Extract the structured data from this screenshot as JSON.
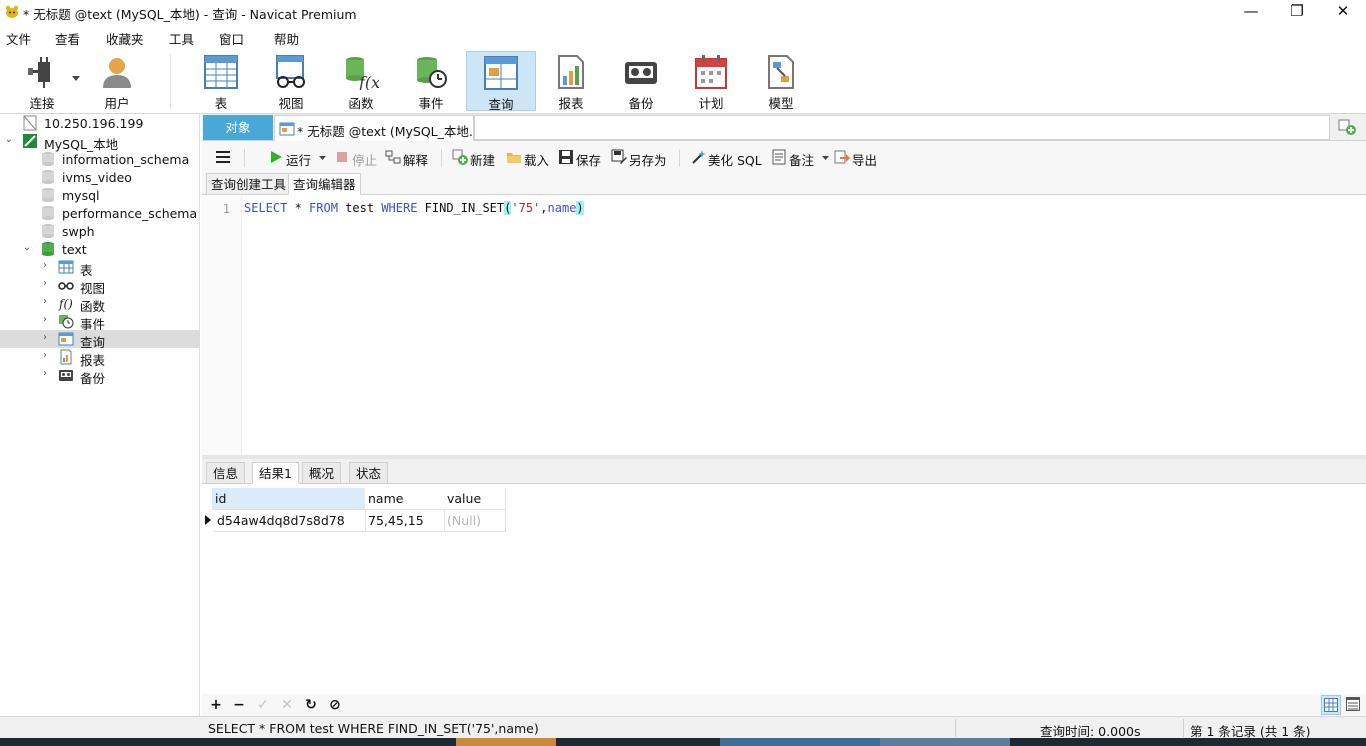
{
  "window": {
    "title": "* 无标题 @text (MySQL_本地) - 查询 - Navicat Premium",
    "minimize_glyph": "—",
    "restore_glyph": "❐",
    "close_glyph": "✕"
  },
  "menu": [
    "文件",
    "查看",
    "收藏夹",
    "工具",
    "窗口",
    "帮助"
  ],
  "toolbar": {
    "connect": "连接",
    "user": "用户",
    "table": "表",
    "view": "视图",
    "function": "函数",
    "event": "事件",
    "query": "查询",
    "report": "报表",
    "backup": "备份",
    "schedule": "计划",
    "model": "模型"
  },
  "navigator": {
    "host": "10.250.196.199",
    "connection": "MySQL_本地",
    "databases": [
      "information_schema",
      "ivms_video",
      "mysql",
      "performance_schema",
      "swph",
      "text"
    ],
    "children": [
      "表",
      "视图",
      "函数",
      "事件",
      "查询",
      "报表",
      "备份"
    ],
    "selected": "查询"
  },
  "tabs": {
    "objects": "对象",
    "query_tab": "* 无标题 @text (MySQL_本地..."
  },
  "query_toolbar": {
    "run": "运行",
    "stop": "停止",
    "explain": "解释",
    "new": "新建",
    "load": "载入",
    "save": "保存",
    "save_as": "另存为",
    "beautify": "美化 SQL",
    "comment": "备注",
    "export": "导出"
  },
  "subtabs": {
    "builder": "查询创建工具",
    "editor": "查询编辑器"
  },
  "editor": {
    "line_number": "1",
    "sql": {
      "select": "SELECT",
      "star": " * ",
      "from": "FROM",
      "table": " test ",
      "where": "WHERE",
      "func": " FIND_IN_SET",
      "lparen": "(",
      "arg1": "'75'",
      "comma": ",",
      "arg2": "name",
      "rparen": ")"
    }
  },
  "result_tabs": [
    "信息",
    "结果1",
    "概况",
    "状态"
  ],
  "result": {
    "columns": [
      "id",
      "name",
      "value"
    ],
    "rows": [
      [
        "d54aw4dq8d7s8d78",
        "75,45,15",
        "(Null)"
      ]
    ]
  },
  "grid_buttons": {
    "add": "+",
    "delete": "−",
    "apply": "✓",
    "discard": "✕",
    "refresh": "↻",
    "stop": "⊘"
  },
  "status": {
    "sql": "SELECT * FROM test WHERE FIND_IN_SET('75',name)",
    "time": "查询时间: 0.000s",
    "records": "第 1 条记录 (共 1 条)"
  },
  "colors": {
    "accent": "#4aa8d8",
    "keyword": "#3a52c8",
    "string": "#b0282f",
    "selected_tool": "#cde6f7"
  }
}
